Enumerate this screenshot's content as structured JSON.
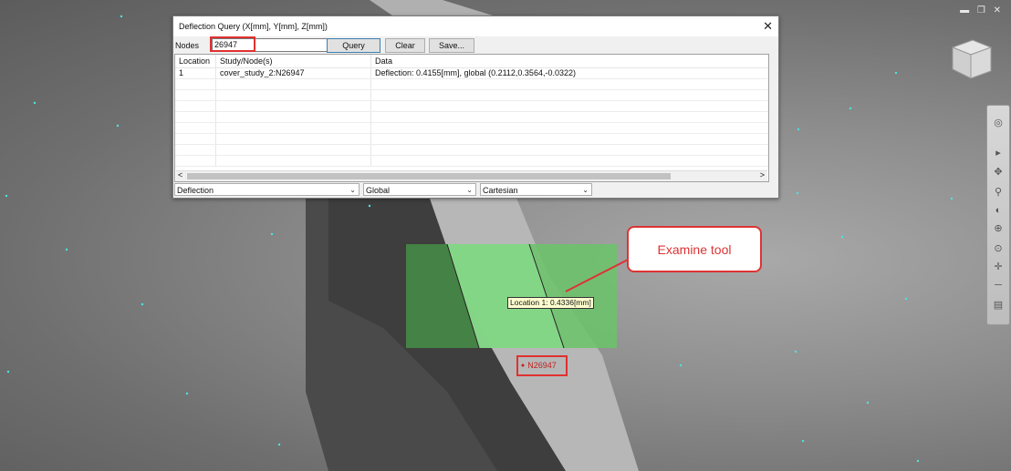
{
  "window_controls": {
    "minimize": "▬",
    "restore": "❐",
    "close": "✕"
  },
  "dialog": {
    "title": "Deflection Query (X[mm], Y[mm], Z[mm])",
    "close": "✕",
    "nodes_label": "Nodes",
    "nodes_value": "26947",
    "buttons": {
      "query": "Query",
      "clear": "Clear",
      "save": "Save..."
    },
    "table": {
      "headers": [
        "Location",
        "Study/Node(s)",
        "Data"
      ],
      "rows": [
        {
          "location": "1",
          "node": "cover_study_2:N26947",
          "data": "Deflection: 0.4155[mm], global (0.2112,0.3564,-0.0322)"
        }
      ]
    },
    "scroll_left": "<",
    "scroll_right": ">",
    "selects": {
      "result": "Deflection",
      "coord": "Global",
      "system": "Cartesian"
    }
  },
  "viewport": {
    "probe_label": "Location 1: 0.4336[mm]",
    "node_label": "N26947",
    "callout": "Examine tool"
  },
  "navbar": {
    "icons": [
      "steering-wheel-icon",
      "orbit-icon",
      "pan-icon",
      "zoom-icon",
      "look-icon",
      "zoom-window-icon",
      "fit-icon",
      "center-icon",
      "walk-icon",
      "menu-icon"
    ]
  },
  "colors": {
    "highlight": "#e03030",
    "callout": "#d33333",
    "probe_green": "#7ed37a"
  }
}
